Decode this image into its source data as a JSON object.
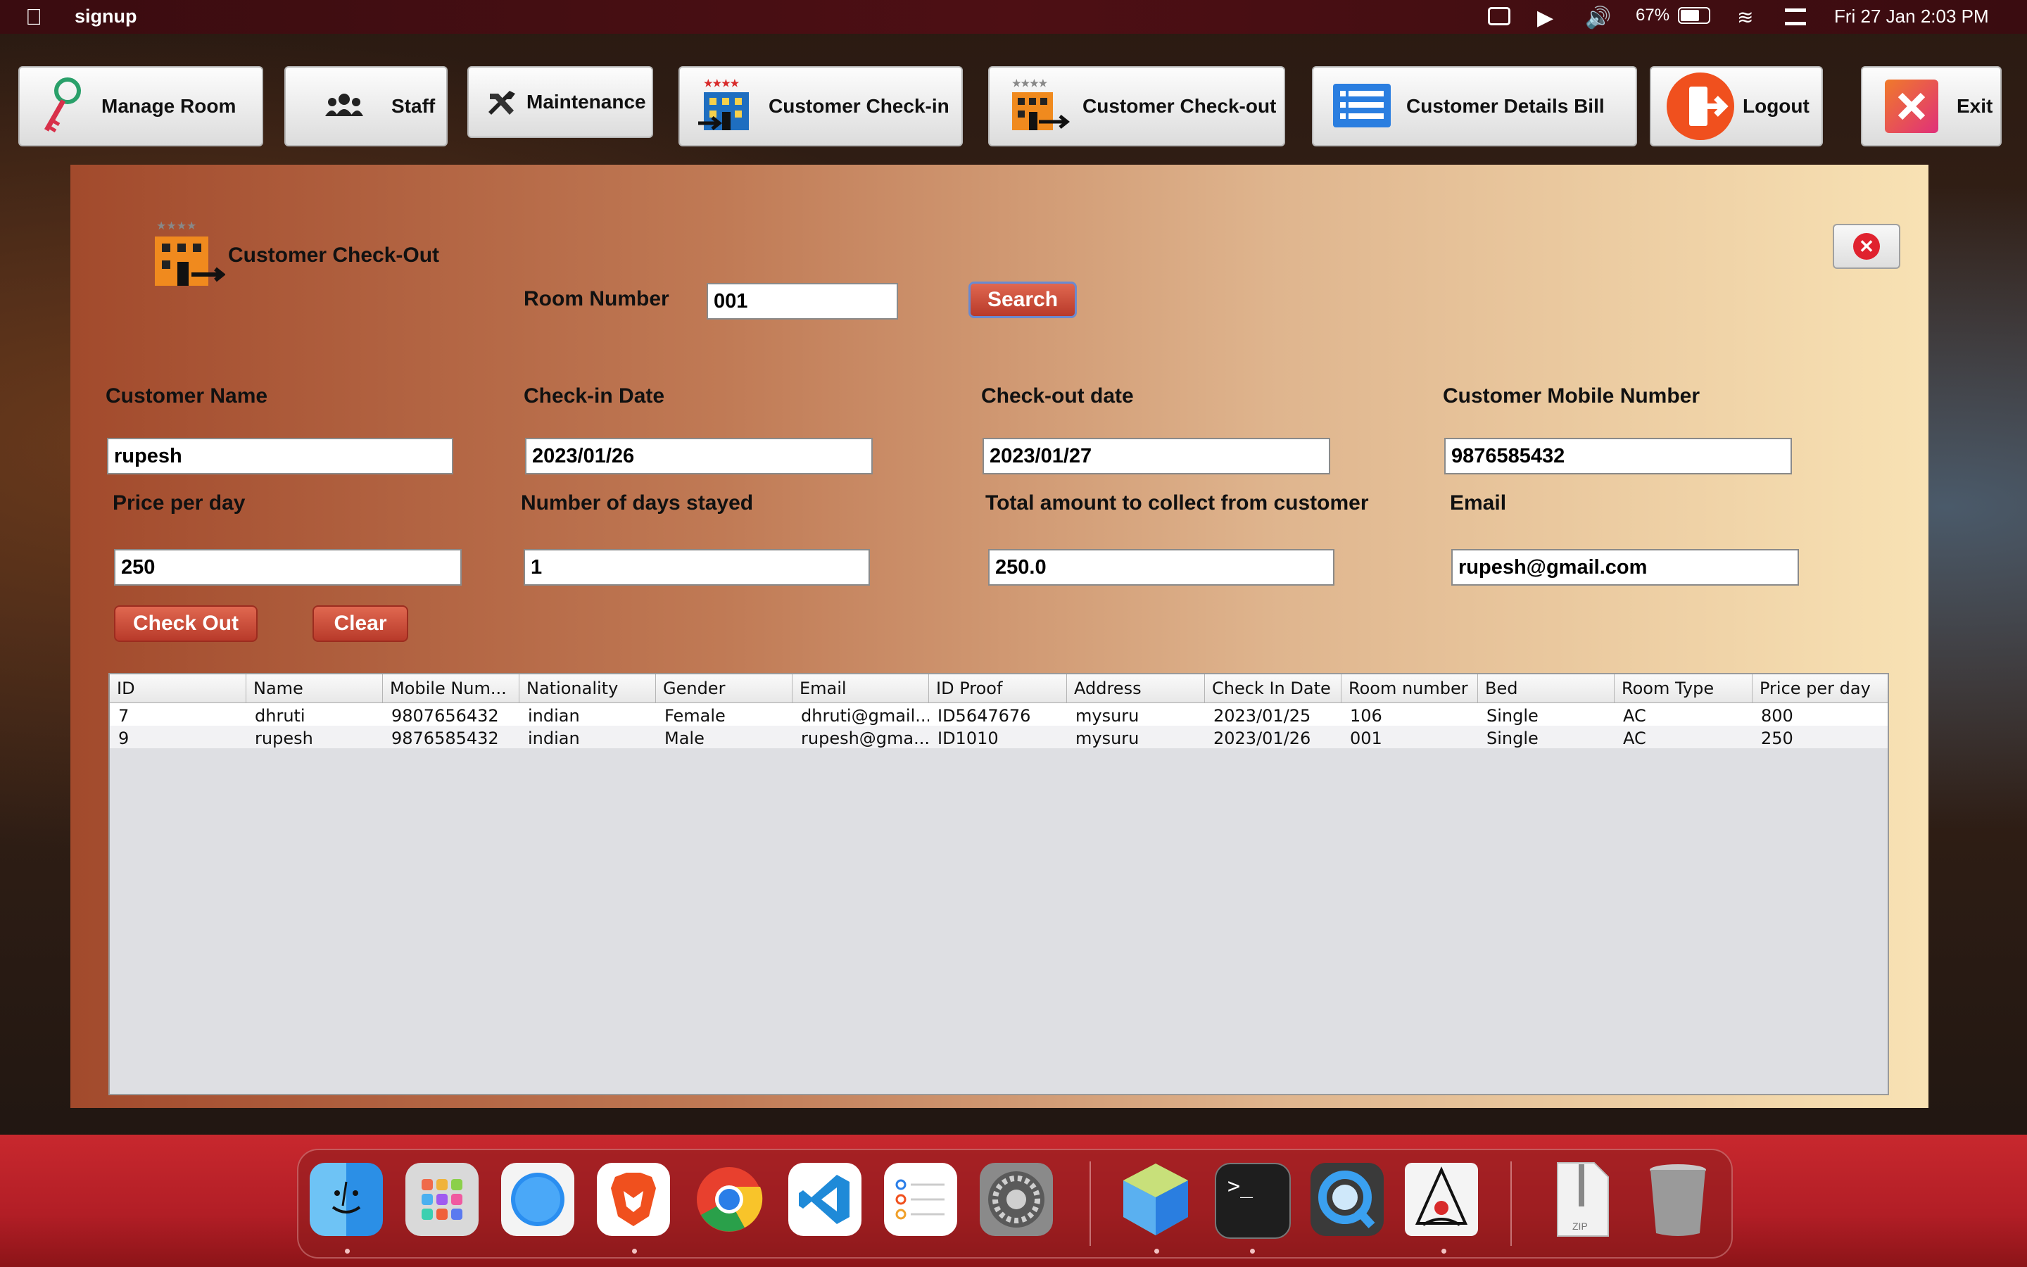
{
  "menubar": {
    "app_name": "signup",
    "battery": "67%",
    "datetime": "Fri 27 Jan  2:03 PM"
  },
  "toolbar": {
    "manage_room": "Manage Room",
    "staff": "Staff",
    "maintenance": "Maintenance",
    "checkin": "Customer Check-in",
    "checkout": "Customer Check-out",
    "details_bill": "Customer Details Bill",
    "logout": "Logout",
    "exit": "Exit"
  },
  "panel": {
    "title": "Customer Check-Out",
    "room_number_label": "Room Number",
    "room_number_value": "001",
    "search_label": "Search",
    "customer_name_label": "Customer Name",
    "customer_name_value": "rupesh",
    "checkin_date_label": "Check-in Date",
    "checkin_date_value": "2023/01/26",
    "checkout_date_label": "Check-out date",
    "checkout_date_value": "2023/01/27",
    "mobile_label": "Customer Mobile Number",
    "mobile_value": "9876585432",
    "price_label": "Price per day",
    "price_value": "250",
    "days_label": "Number of days stayed",
    "days_value": "1",
    "total_label": "Total amount to collect from customer",
    "total_value": "250.0",
    "email_label": "Email",
    "email_value": "rupesh@gmail.com",
    "checkout_button": "Check Out",
    "clear_button": "Clear"
  },
  "table": {
    "columns": [
      "ID",
      "Name",
      "Mobile Num...",
      "Nationality",
      "Gender",
      "Email",
      "ID Proof",
      "Address",
      "Check In Date",
      "Room number",
      "Bed",
      "Room Type",
      "Price per day"
    ],
    "rows": [
      [
        "7",
        "dhruti",
        "9807656432",
        "indian",
        "Female",
        "dhruti@gmail...",
        "ID5647676",
        "mysuru",
        "2023/01/25",
        "106",
        "Single",
        "AC",
        "800"
      ],
      [
        "9",
        "rupesh",
        "9876585432",
        "indian",
        "Male",
        "rupesh@gma...",
        "ID1010",
        "mysuru",
        "2023/01/26",
        "001",
        "Single",
        "AC",
        "250"
      ]
    ]
  },
  "dock": {
    "apps": [
      "finder-icon",
      "launchpad-icon",
      "safari-icon",
      "brave-icon",
      "chrome-icon",
      "vscode-icon",
      "reminders-icon",
      "system-settings-icon",
      "netbeans-icon",
      "terminal-icon",
      "quicktime-icon",
      "java-icon",
      "zip-icon",
      "trash-icon"
    ],
    "zip_label": "ZIP"
  },
  "colors": {
    "accent_red": "#c8282e",
    "button_red": "#c44a34",
    "panel_start": "#a24a2c",
    "panel_end": "#f8e2b4"
  }
}
